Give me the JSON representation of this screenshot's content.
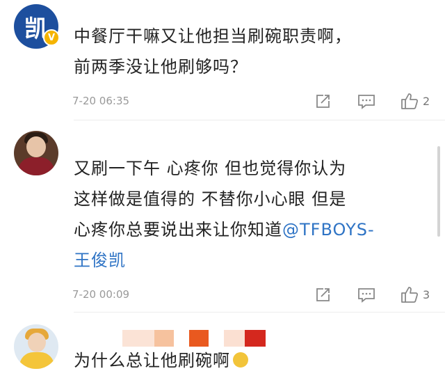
{
  "comments": [
    {
      "avatar_glyph": "凯",
      "verified_badge": "V",
      "lines": [
        "中餐厅干嘛又让他担当刷碗职责啊，",
        "前两季没让他刷够吗？"
      ],
      "time": "7-20 06:35",
      "likes": "2"
    },
    {
      "lines": [
        "又刷一下午 心疼你 但也觉得你认为",
        "这样做是值得的 不替你小心眼 但是",
        "心疼你总要说出来让你知道"
      ],
      "mention_part1": "@TFBOYS-",
      "mention_part2": "王俊凯",
      "time": "7-20 00:09",
      "likes": "3"
    },
    {
      "lines": [
        "为什么总让他刷碗啊"
      ]
    }
  ],
  "icons": {
    "share": "share-icon",
    "reply": "comment-icon",
    "like": "thumbs-up-icon"
  },
  "colors": {
    "mention": "#2f74c5",
    "verified": "#f5b400"
  }
}
